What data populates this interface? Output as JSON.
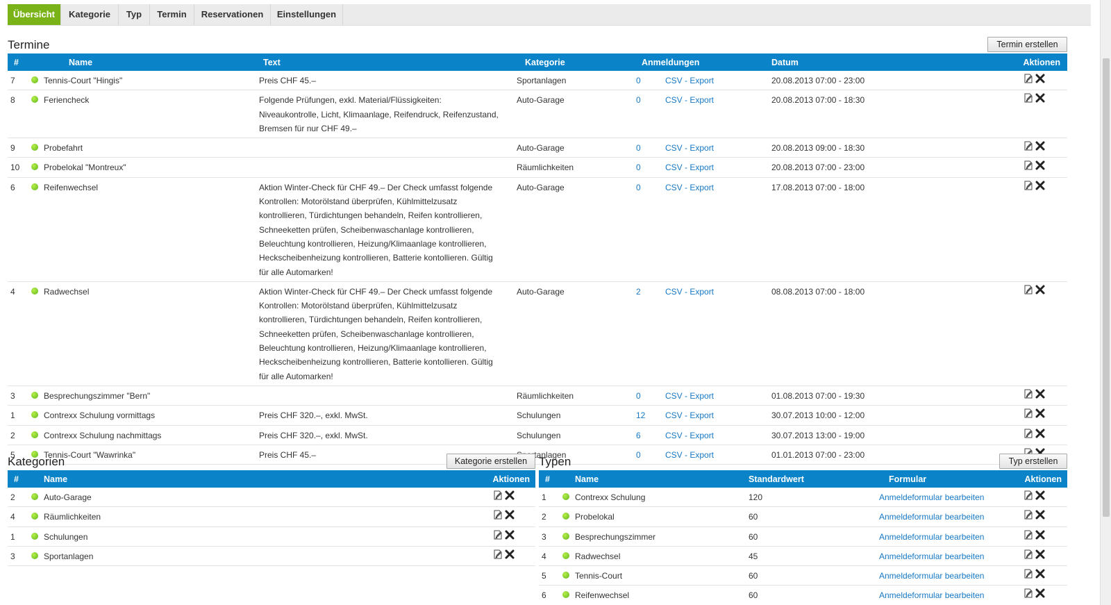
{
  "tabs": [
    "Übersicht",
    "Kategorie",
    "Typ",
    "Termin",
    "Reservationen",
    "Einstellungen"
  ],
  "termine": {
    "title": "Termine",
    "create_button": "Termin erstellen",
    "columns": [
      "#",
      "Name",
      "Text",
      "Kategorie",
      "Anmeldungen",
      "Datum",
      "Aktionen"
    ],
    "rows": [
      {
        "id": "7",
        "name": "Tennis-Court \"Hingis\"",
        "text": "Preis CHF 45.–",
        "category": "Sportanlagen",
        "count": "0",
        "export": "CSV - Export",
        "date": "20.08.2013 07:00 - 23:00"
      },
      {
        "id": "8",
        "name": "Feriencheck",
        "text": "Folgende Prüfungen, exkl. Material/Flüssigkeiten: Niveaukontrolle, Licht, Klimaanlage, Reifendruck, Reifenzustand, Bremsen für nur CHF 49.–",
        "category": "Auto-Garage",
        "count": "0",
        "export": "CSV - Export",
        "date": "20.08.2013 07:00 - 18:30"
      },
      {
        "id": "9",
        "name": "Probefahrt",
        "text": "",
        "category": "Auto-Garage",
        "count": "0",
        "export": "CSV - Export",
        "date": "20.08.2013 09:00 - 18:30"
      },
      {
        "id": "10",
        "name": "Probelokal \"Montreux\"",
        "text": "",
        "category": "Räumlichkeiten",
        "count": "0",
        "export": "CSV - Export",
        "date": "20.08.2013 07:00 - 23:00"
      },
      {
        "id": "6",
        "name": "Reifenwechsel",
        "text": "Aktion Winter-Check für CHF 49.– Der Check umfasst folgende Kontrollen: Motorölstand überprüfen, Kühlmittelzusatz kontrollieren, Türdichtungen behandeln, Reifen kontrollieren, Schneeketten prüfen, Scheibenwaschanlage kontrollieren, Beleuchtung kontrollieren, Heizung/Klimaanlage kontrollieren, Heckscheibenheizung kontrollieren, Batterie kontollieren. Gültig für alle Automarken!",
        "category": "Auto-Garage",
        "count": "0",
        "export": "CSV - Export",
        "date": "17.08.2013 07:00 - 18:00"
      },
      {
        "id": "4",
        "name": "Radwechsel",
        "text": "Aktion Winter-Check für CHF 49.– Der Check umfasst folgende Kontrollen: Motorölstand überprüfen, Kühlmittelzusatz kontrollieren, Türdichtungen behandeln, Reifen kontrollieren, Schneeketten prüfen, Scheibenwaschanlage kontrollieren, Beleuchtung kontrollieren, Heizung/Klimaanlage kontrollieren, Heckscheibenheizung kontrollieren, Batterie kontollieren. Gültig für alle Automarken!",
        "category": "Auto-Garage",
        "count": "2",
        "export": "CSV - Export",
        "date": "08.08.2013 07:00 - 18:00"
      },
      {
        "id": "3",
        "name": "Besprechungszimmer \"Bern\"",
        "text": "",
        "category": "Räumlichkeiten",
        "count": "0",
        "export": "CSV - Export",
        "date": "01.08.2013 07:00 - 19:30"
      },
      {
        "id": "1",
        "name": "Contrexx Schulung vormittags",
        "text": "Preis CHF 320.–, exkl. MwSt.",
        "category": "Schulungen",
        "count": "12",
        "export": "CSV - Export",
        "date": "30.07.2013 10:00 - 12:00"
      },
      {
        "id": "2",
        "name": "Contrexx Schulung nachmittags",
        "text": "Preis CHF 320.–, exkl. MwSt.",
        "category": "Schulungen",
        "count": "6",
        "export": "CSV - Export",
        "date": "30.07.2013 13:00 - 19:00"
      },
      {
        "id": "5",
        "name": "Tennis-Court \"Wawrinka\"",
        "text": "Preis CHF 45.–",
        "category": "Sportanlagen",
        "count": "0",
        "export": "CSV - Export",
        "date": "01.01.2013 07:00 - 23:00"
      }
    ]
  },
  "kategorien": {
    "title": "Kategorien",
    "create_button": "Kategorie erstellen",
    "columns": [
      "#",
      "Name",
      "Aktionen"
    ],
    "rows": [
      {
        "id": "2",
        "name": "Auto-Garage"
      },
      {
        "id": "4",
        "name": "Räumlichkeiten"
      },
      {
        "id": "1",
        "name": "Schulungen"
      },
      {
        "id": "3",
        "name": "Sportanlagen"
      }
    ]
  },
  "typen": {
    "title": "Typen",
    "create_button": "Typ erstellen",
    "columns": [
      "#",
      "Name",
      "Standardwert",
      "Formular",
      "Aktionen"
    ],
    "rows": [
      {
        "id": "1",
        "name": "Contrexx Schulung",
        "value": "120",
        "form": "Anmeldeformular bearbeiten"
      },
      {
        "id": "2",
        "name": "Probelokal",
        "value": "60",
        "form": "Anmeldeformular bearbeiten"
      },
      {
        "id": "3",
        "name": "Besprechungszimmer",
        "value": "60",
        "form": "Anmeldeformular bearbeiten"
      },
      {
        "id": "4",
        "name": "Radwechsel",
        "value": "45",
        "form": "Anmeldeformular bearbeiten"
      },
      {
        "id": "5",
        "name": "Tennis-Court",
        "value": "60",
        "form": "Anmeldeformular bearbeiten"
      },
      {
        "id": "6",
        "name": "Reifenwechsel",
        "value": "60",
        "form": "Anmeldeformular bearbeiten"
      }
    ]
  },
  "colors": {
    "accent_green": "#7ab317",
    "header_blue": "#0a83c8",
    "link_blue": "#1678c4",
    "status_dot": "#6fc421"
  },
  "icons": {
    "edit": "edit-icon",
    "delete": "delete-icon",
    "status": "status-dot-icon"
  }
}
